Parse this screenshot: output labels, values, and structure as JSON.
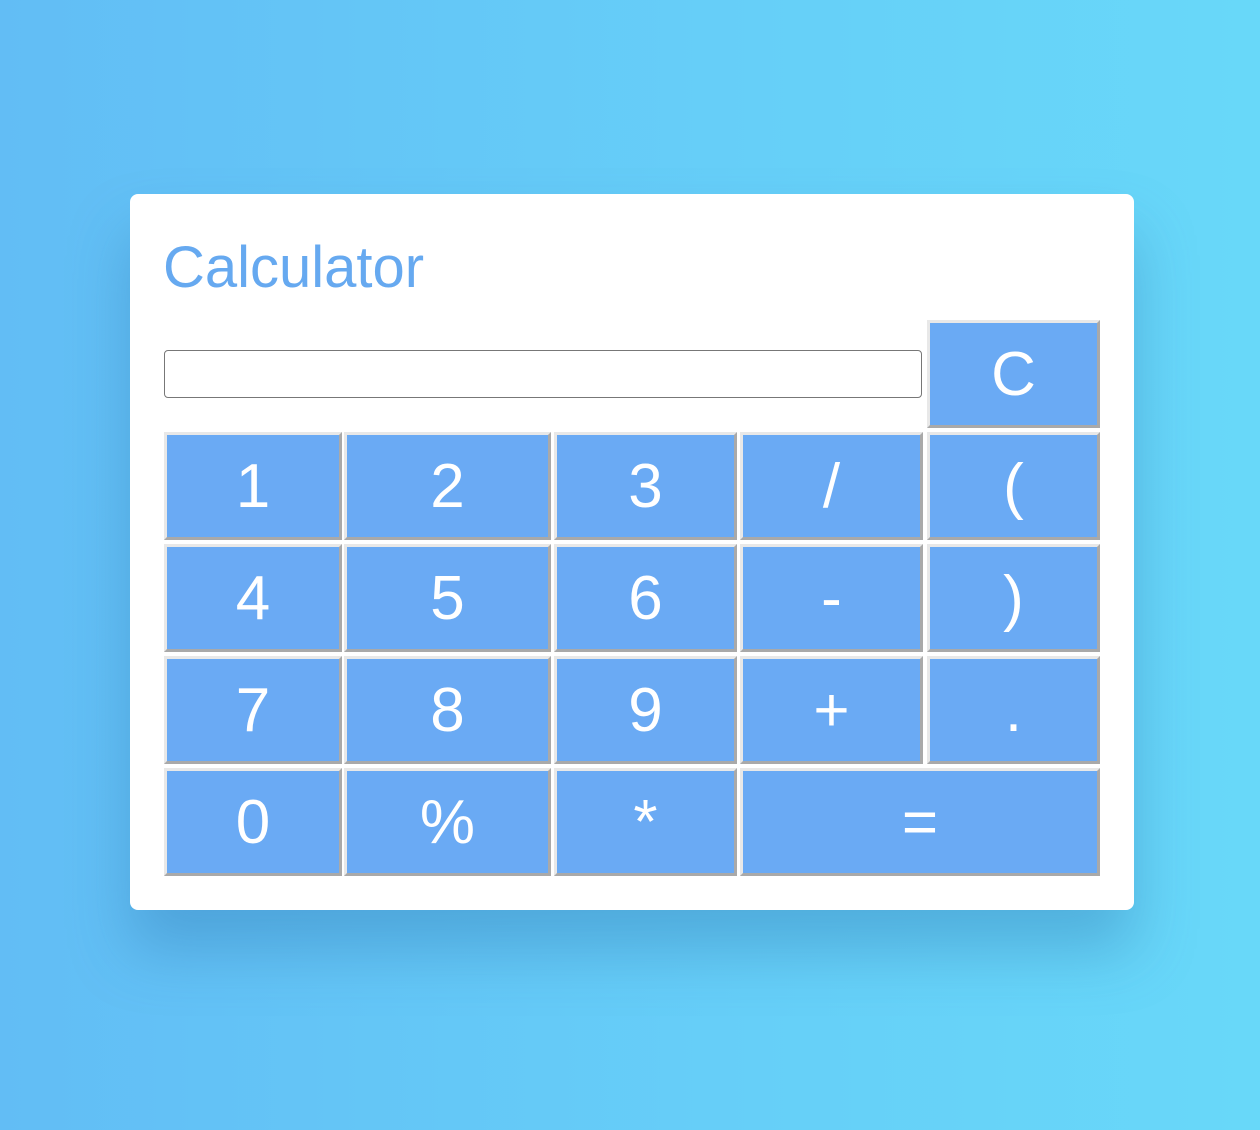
{
  "app": {
    "title": "Calculator"
  },
  "display": {
    "value": "",
    "placeholder": ""
  },
  "buttons": {
    "clear": "C",
    "one": "1",
    "two": "2",
    "three": "3",
    "divide": "/",
    "open_paren": "(",
    "four": "4",
    "five": "5",
    "six": "6",
    "minus": "-",
    "close_paren": ")",
    "seven": "7",
    "eight": "8",
    "nine": "9",
    "plus": "+",
    "decimal": ".",
    "zero": "0",
    "percent": "%",
    "multiply": "*",
    "equals": "="
  },
  "colors": {
    "background_start": "#62bdf5",
    "background_end": "#68d8f9",
    "accent": "#66a9f0",
    "button": "#6aaaf4",
    "button_text": "#ffffff"
  }
}
